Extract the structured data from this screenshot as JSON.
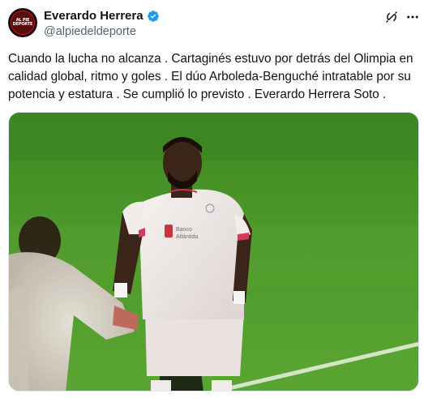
{
  "author": {
    "display_name": "Everardo Herrera",
    "handle": "@alpiedeldeporte",
    "verified": true,
    "avatar_icon": "al-pie-del-deporte-logo",
    "avatar_text": "AL PIE DEL DEPORTE"
  },
  "header_actions": {
    "grok_icon": "grok-icon",
    "more_icon": "more-horizontal-icon"
  },
  "tweet": {
    "text": "Cuando la lucha no alcanza . Cartaginés estuvo por detrás del Olimpia en calidad global, ritmo y goles . El dúo Arboleda-Benguché intratable por su potencia y estatura . Se cumplió lo previsto . Everardo Herrera Soto ."
  },
  "media": {
    "jersey_sponsor_line1": "Banco",
    "jersey_sponsor_line2": "Atlántida"
  },
  "colors": {
    "verified_blue": "#1d9bf0",
    "text_primary": "#0f1419",
    "text_secondary": "#536471",
    "pitch_green": "#4f9a2c"
  }
}
